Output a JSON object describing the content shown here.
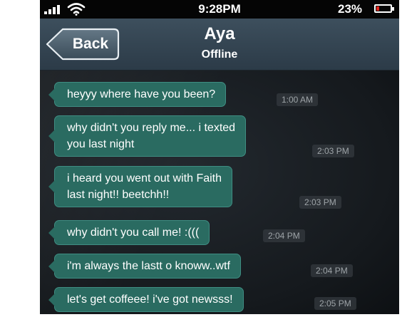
{
  "status_bar": {
    "time": "9:28PM",
    "battery_percent": "23%",
    "battery_level": 0.23,
    "battery_color": "#e3241b",
    "signal_icon": "signal-bars-icon",
    "wifi_icon": "wifi-icon"
  },
  "nav": {
    "back_label": "Back",
    "contact_name": "Aya",
    "contact_status": "Offline"
  },
  "messages": [
    {
      "lines": [
        "heyyy where have you been?"
      ],
      "time": "1:00 AM"
    },
    {
      "lines": [
        "why didn't you reply me... i texted",
        "you last night"
      ],
      "time": "2:03 PM"
    },
    {
      "lines": [
        "i heard you went out with Faith",
        "last night!! beetchh!!"
      ],
      "time": "2:03 PM"
    },
    {
      "lines": [
        "why didn't you call me! :((("
      ],
      "time": "2:04 PM"
    },
    {
      "lines": [
        "i'm always the lastt o knoww..wtf"
      ],
      "time": "2:04 PM"
    },
    {
      "lines": [
        "let's get coffeee! i've got newsss!"
      ],
      "time": "2:05 PM"
    }
  ],
  "colors": {
    "bubble": "#2a6b61",
    "nav_bar": "#3d4f5d",
    "battery_low": "#e3241b"
  }
}
